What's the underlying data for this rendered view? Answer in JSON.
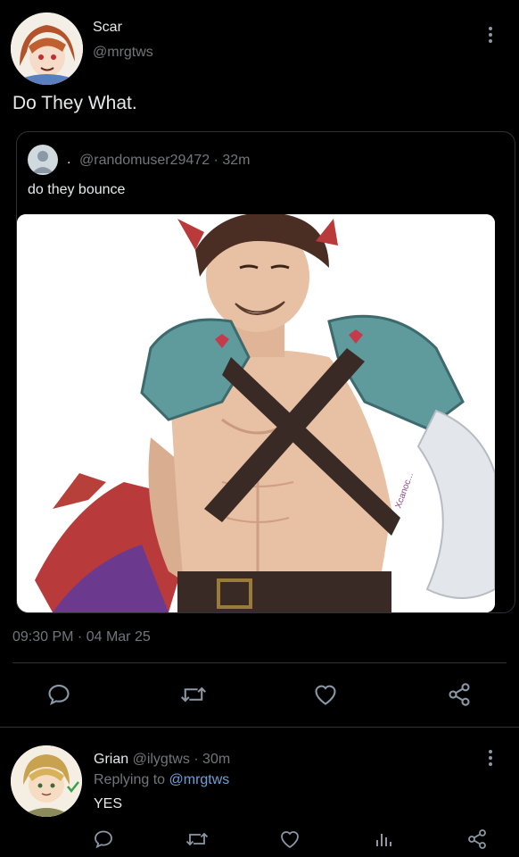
{
  "tweet": {
    "author": {
      "name": "Scar",
      "handle": "@mrgtws"
    },
    "text": "Do They What.",
    "timestamp": "09:30 PM · 04 Mar 25"
  },
  "quote": {
    "handle": "@randomuser29472",
    "time": "32m",
    "text": "do they bounce",
    "image_signature": "Xcanoc..."
  },
  "actions": [
    "reply-icon",
    "retweet-icon",
    "like-icon",
    "share-icon"
  ],
  "reply": {
    "name": "Grian",
    "handle": "@ilygtws",
    "time": "30m",
    "replying_prefix": "Replying to",
    "replying_to": "@mrgtws",
    "text": "YES",
    "actions": [
      "reply-icon",
      "retweet-icon",
      "like-icon",
      "views-icon",
      "share-icon"
    ]
  },
  "colors": {
    "background": "#000000",
    "text": "#e7e9ea",
    "muted": "#71767b",
    "link": "#1d9bf0",
    "divider": "#2f3336"
  }
}
